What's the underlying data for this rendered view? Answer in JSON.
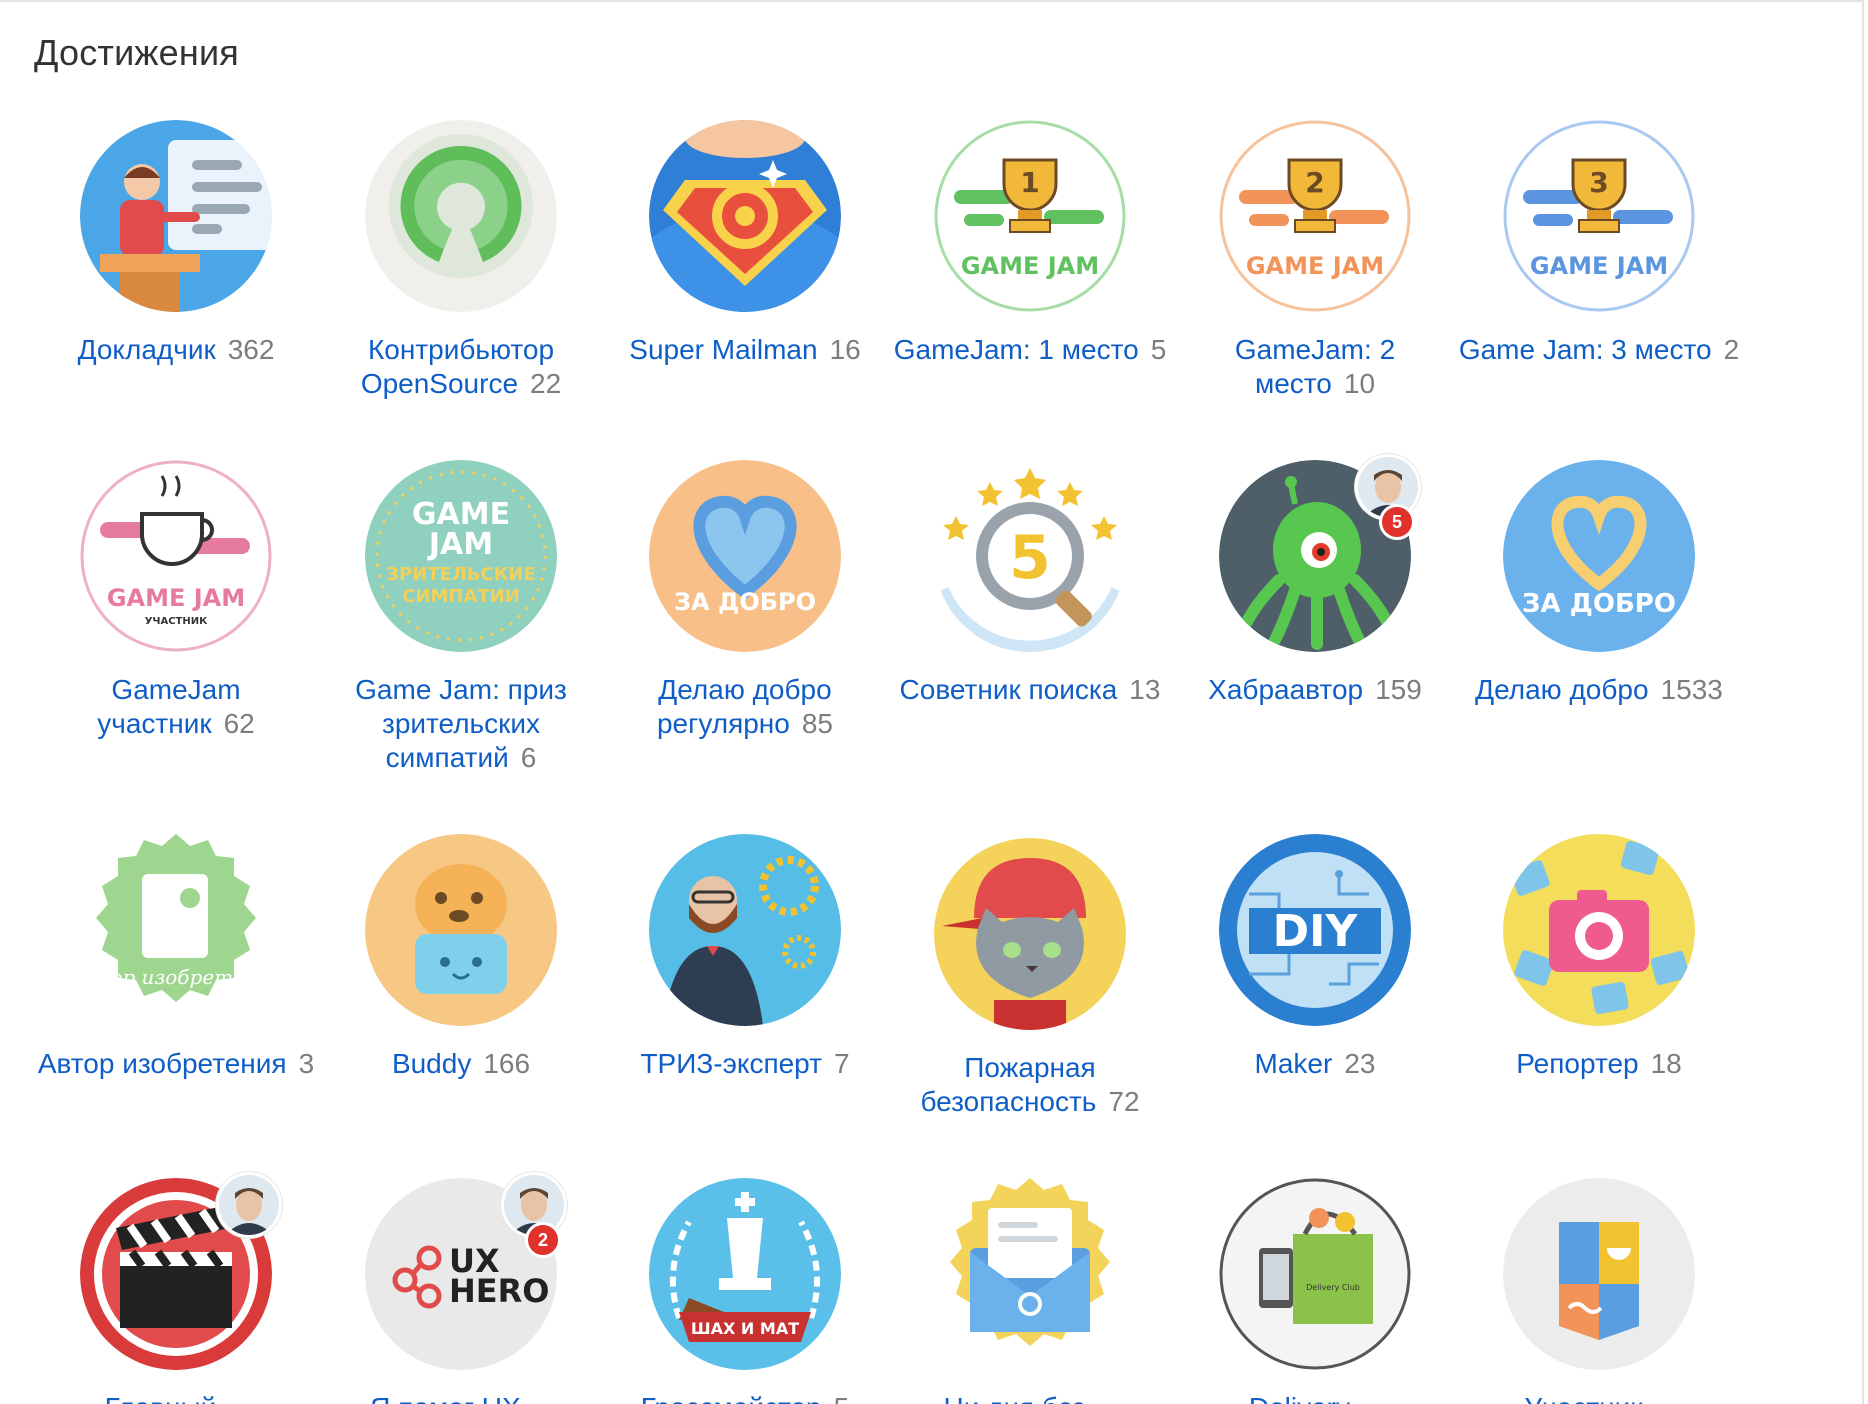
{
  "section_title": "Достижения",
  "badges": [
    {
      "name": "Докладчик",
      "count": "362",
      "icon": "speaker-icon",
      "color": "#4aa6e6"
    },
    {
      "name": "Контрибьютор OpenSource",
      "count": "22",
      "icon": "open-source-icon",
      "color": "#5fbd5a"
    },
    {
      "name": "Super Mailman",
      "count": "16",
      "icon": "super-mailman-icon",
      "color": "#2f7fd6"
    },
    {
      "name": "GameJam: 1 место",
      "count": "5",
      "icon": "gamejam-first-place-icon",
      "color": "#68c46b",
      "cup_text": "1",
      "jam_text": "GAME JAM"
    },
    {
      "name": "GameJam: 2 место",
      "count": "10",
      "icon": "gamejam-second-place-icon",
      "color": "#f2a060",
      "cup_text": "2",
      "jam_text": "GAME JAM"
    },
    {
      "name": "Game Jam: 3 место",
      "count": "2",
      "icon": "gamejam-third-place-icon",
      "color": "#6aa4e6",
      "cup_text": "3",
      "jam_text": "GAME JAM"
    },
    {
      "name": "GameJam участник",
      "count": "62",
      "icon": "gamejam-participant-icon",
      "color": "#e07a9c",
      "jam_text": "GAME JAM",
      "sub_text": "УЧАСТНИК"
    },
    {
      "name": "Game Jam: приз зрительских симпатий",
      "count": "6",
      "icon": "gamejam-audience-award-icon",
      "color": "#8fd0bf",
      "line1": "GAME",
      "line2": "JAM",
      "line3": "ЗРИТЕЛЬСКИЕ",
      "line4": "СИМПАТИИ"
    },
    {
      "name": "Делаю добро регулярно",
      "count": "85",
      "icon": "heart-regular-icon",
      "color": "#f8c088",
      "caption": "ЗА ДОБРО"
    },
    {
      "name": "Советник поиска",
      "count": "13",
      "icon": "search-advisor-icon",
      "color": "#f2d24a",
      "big_num": "5"
    },
    {
      "name": "Хабраавтор",
      "count": "159",
      "icon": "habr-author-icon",
      "color": "#4e5f6a",
      "notify": "5"
    },
    {
      "name": "Делаю добро",
      "count": "1533",
      "icon": "heart-icon",
      "color": "#6bb1ec",
      "caption": "ЗА ДОБРО"
    },
    {
      "name": "Автор изобретения",
      "count": "3",
      "icon": "inventor-scroll-icon",
      "color": "#9fd68f",
      "script": "автор изобретения"
    },
    {
      "name": "Buddy",
      "count": "166",
      "icon": "buddy-icon",
      "color": "#f7c884"
    },
    {
      "name": "ТРИЗ-эксперт",
      "count": "7",
      "icon": "triz-expert-icon",
      "color": "#56bde6"
    },
    {
      "name": "Пожарная безопасность",
      "count": "72",
      "icon": "fire-safety-cat-icon",
      "color": "#f5d35a"
    },
    {
      "name": "Maker",
      "count": "23",
      "icon": "maker-diy-icon",
      "color": "#2b7fd0",
      "caption": "DIY"
    },
    {
      "name": "Репортер",
      "count": "18",
      "icon": "reporter-camera-icon",
      "color": "#f3dd5a"
    },
    {
      "name": "Главный ...",
      "count": "",
      "icon": "director-clapper-icon",
      "color": "#d93a3a"
    },
    {
      "name": "Я помог UX ...",
      "count": "",
      "icon": "ux-hero-icon",
      "color": "#e9e9e9",
      "caption_top": "UX",
      "caption_bottom": "HERO",
      "notify": "2"
    },
    {
      "name": "Гроссмейстер",
      "count": "5",
      "icon": "grandmaster-chess-icon",
      "color": "#5ac0ea",
      "ribbon": "ШАХ И МАТ"
    },
    {
      "name": "Ни дня без ...",
      "count": "",
      "icon": "mail-envelope-icon",
      "color": "#f4d35b"
    },
    {
      "name": "Delivery ...",
      "count": "",
      "icon": "delivery-club-icon",
      "color": "#f0f0f0",
      "bag_text": "Delivery Club"
    },
    {
      "name": "Участник ...",
      "count": "",
      "icon": "participant-shield-icon",
      "color": "#ececec"
    }
  ]
}
